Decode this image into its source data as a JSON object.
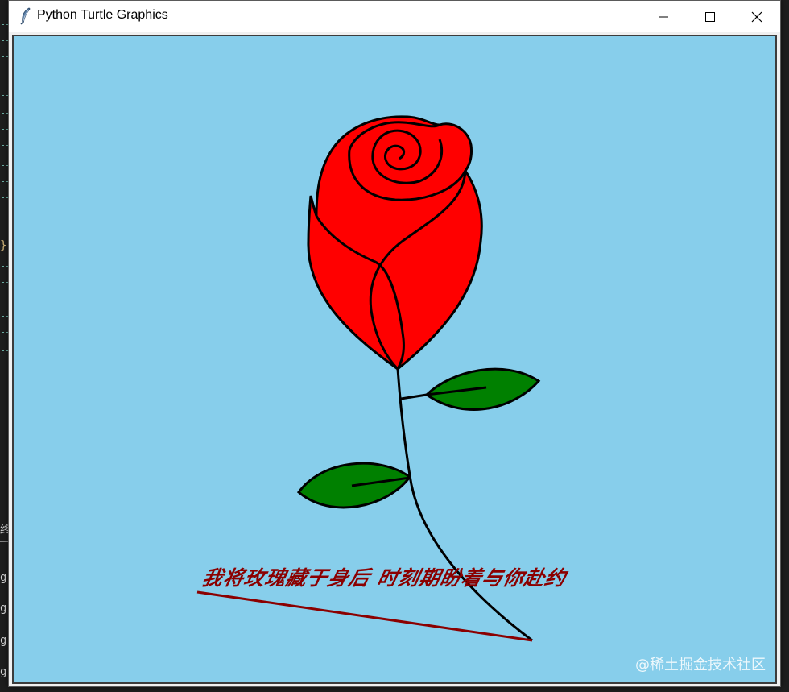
{
  "window": {
    "title": "Python Turtle Graphics",
    "icon": "feather-icon",
    "controls": {
      "minimize_icon": "minimize-icon",
      "maximize_icon": "maximize-icon",
      "close_icon": "close-icon"
    }
  },
  "canvas": {
    "background_color": "#87ceeb",
    "caption": "我将玫瑰藏于身后 时刻期盼着与你赴约",
    "caption_color": "#8b0000",
    "watermark": "@稀土掘金技术社区"
  },
  "drawing": {
    "rose_fill": "#ff0000",
    "leaf_fill": "#008000",
    "outline_color": "#000000",
    "underline_color": "#8b0000"
  },
  "background_editor": {
    "fragments": [
      "}",
      "终",
      "g",
      "g",
      "g",
      "g"
    ]
  }
}
